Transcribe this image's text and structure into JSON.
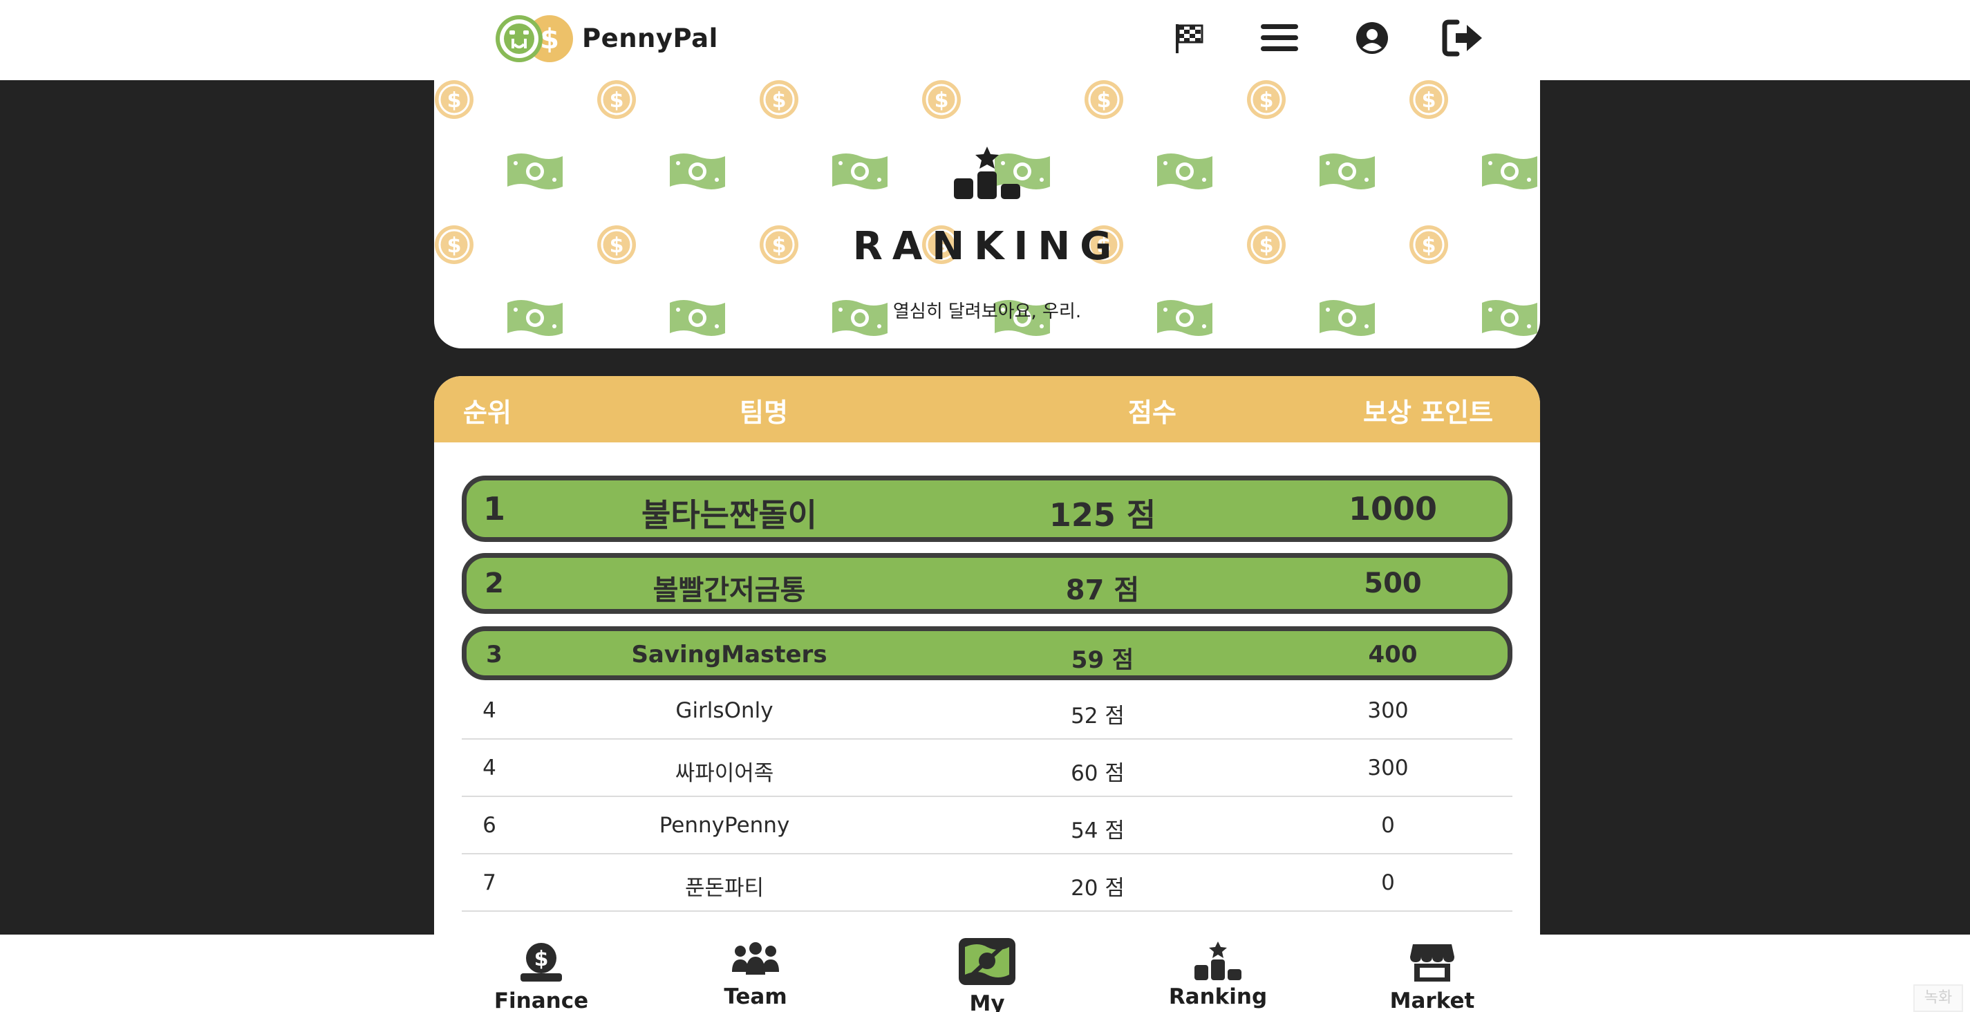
{
  "header": {
    "brand": "PennyPal",
    "icons": [
      "checkered-flag-icon",
      "hamburger-menu-icon",
      "user-circle-icon",
      "logout-icon"
    ]
  },
  "hero": {
    "title": "RANKING",
    "subtitle": "열심히 달려보아요, 우리."
  },
  "table": {
    "headers": {
      "rank": "순위",
      "team": "팀명",
      "score": "점수",
      "reward": "보상 포인트"
    },
    "top_rows": [
      {
        "rank": "1",
        "team": "불타는짠돌이",
        "score": "125 점",
        "reward": "1000"
      },
      {
        "rank": "2",
        "team": "볼빨간저금통",
        "score": "87 점",
        "reward": "500"
      },
      {
        "rank": "3",
        "team": "SavingMasters",
        "score": "59 점",
        "reward": "400"
      }
    ],
    "rows": [
      {
        "rank": "4",
        "team": "GirlsOnly",
        "score": "52 점",
        "reward": "300"
      },
      {
        "rank": "4",
        "team": "싸파이어족",
        "score": "60 점",
        "reward": "300"
      },
      {
        "rank": "6",
        "team": "PennyPenny",
        "score": "54 점",
        "reward": "0"
      },
      {
        "rank": "7",
        "team": "푼돈파티",
        "score": "20 점",
        "reward": "0"
      }
    ]
  },
  "bottom_nav": {
    "items": [
      {
        "label": "Finance",
        "icon": "money-bag-icon"
      },
      {
        "label": "Team",
        "icon": "team-icon"
      },
      {
        "label": "My Spending",
        "icon": "spending-icon"
      },
      {
        "label": "Ranking",
        "icon": "podium-icon"
      },
      {
        "label": "Market",
        "icon": "store-icon"
      }
    ]
  },
  "watermark": "녹화",
  "colors": {
    "accent_green": "#88ba56",
    "accent_yellow": "#edc169",
    "background": "#232323",
    "border": "#3d3d3d"
  }
}
